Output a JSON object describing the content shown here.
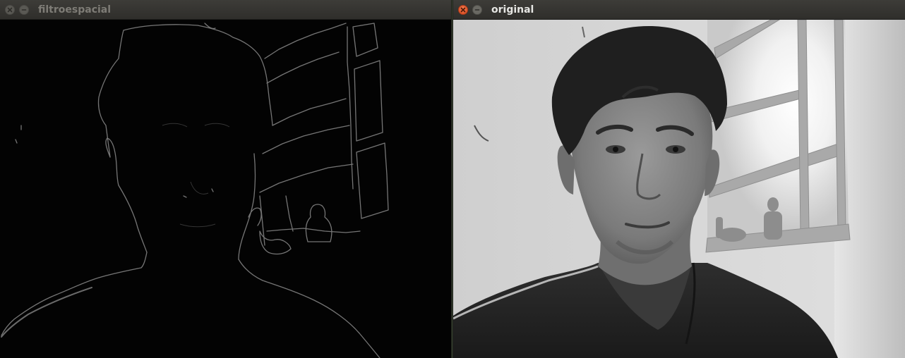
{
  "windows": {
    "left": {
      "title": "filtroespacial",
      "image_description_icon": "edge-filtered-webcam-image",
      "state": "inactive"
    },
    "right": {
      "title": "original",
      "image_description_icon": "grayscale-webcam-image",
      "state": "active"
    }
  },
  "colors": {
    "titlebar": "#3d3c38",
    "close_active": "#e05b2b",
    "title_active": "#e6e6e3",
    "title_inactive": "#7e7c76"
  }
}
